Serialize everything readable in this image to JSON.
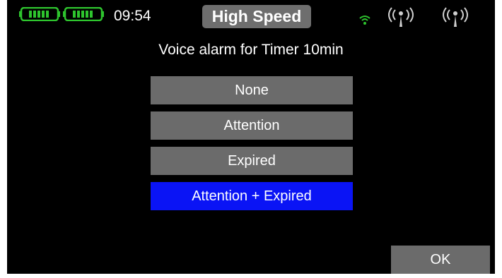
{
  "status": {
    "time": "09:54",
    "mode": "High Speed",
    "battery_icons": [
      "battery-icon",
      "battery-icon"
    ],
    "signal_icons": [
      "wifi-signal-icon",
      "antenna-icon",
      "antenna-icon"
    ]
  },
  "screen": {
    "title": "Voice alarm for Timer 10min",
    "options": [
      {
        "label": "None",
        "selected": false
      },
      {
        "label": "Attention",
        "selected": false
      },
      {
        "label": "Expired",
        "selected": false
      },
      {
        "label": "Attention + Expired",
        "selected": true
      }
    ],
    "ok_label": "OK"
  },
  "colors": {
    "background": "#000000",
    "button": "#6b6b6b",
    "selected": "#0a14f5",
    "battery_green": "#2ec52e"
  }
}
